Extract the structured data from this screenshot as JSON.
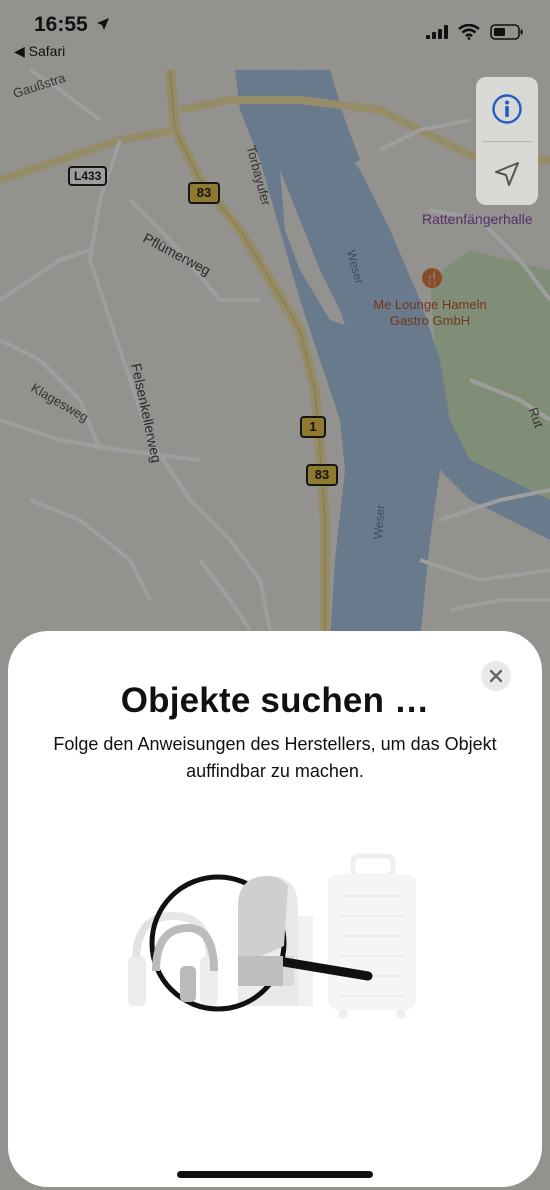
{
  "status_bar": {
    "time": "16:55",
    "back_app": "◀ Safari"
  },
  "map": {
    "labels": {
      "gauss": "Gaußstra",
      "pfluemerweg": "Pflümerweg",
      "torbayufer": "Torbayufer",
      "weser1": "Weser",
      "weser2": "Weser",
      "felsenkellerweg": "Felsenkellerweg",
      "klagesweg": "Klagesweg",
      "rattenfaenger": "Rattenfängerhalle",
      "me_lounge_1": "Me Lounge Hameln",
      "me_lounge_2": "Gastro GmbH",
      "rut": "Rut"
    },
    "shields": {
      "l433": "L433",
      "b83_top": "83",
      "b1": "1",
      "b83_bottom": "83"
    }
  },
  "map_controls": {
    "info_icon": "info-icon",
    "location_icon": "location-arrow-icon",
    "accent": "#1f5fc4"
  },
  "sheet": {
    "title": "Objekte suchen …",
    "subtitle": "Folge den Anweisungen des Herstellers, um das Objekt auffindbar zu machen."
  }
}
